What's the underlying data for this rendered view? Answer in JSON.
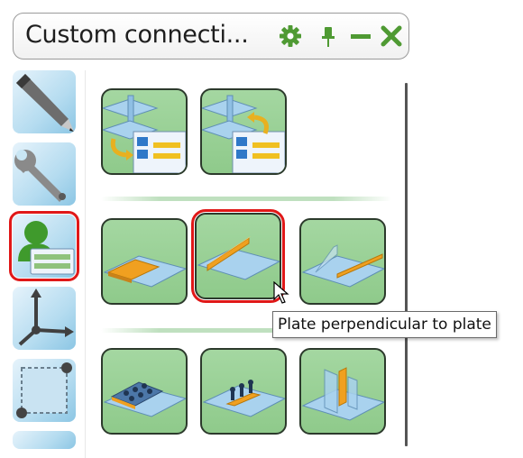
{
  "window": {
    "title": "Custom connecti...",
    "buttons": [
      {
        "name": "settings-icon"
      },
      {
        "name": "pin-icon"
      },
      {
        "name": "minimize-icon"
      },
      {
        "name": "close-icon"
      }
    ]
  },
  "sidebar": {
    "items": [
      {
        "icon": "pen-icon",
        "selected": false
      },
      {
        "icon": "wrench-icon",
        "selected": false
      },
      {
        "icon": "custom-component-user-icon",
        "selected": true
      },
      {
        "icon": "coordinate-axes-icon",
        "selected": false
      },
      {
        "icon": "dashed-plane-icon",
        "selected": false
      }
    ]
  },
  "tiles": [
    {
      "icon": "explode-beam-connection-icon",
      "selected": false
    },
    {
      "icon": "explode-beam-connection-reverse-icon",
      "selected": false
    },
    {
      "icon": "plate-on-plate-icon",
      "selected": false
    },
    {
      "icon": "plate-perpendicular-to-plate-icon",
      "selected": true
    },
    {
      "icon": "plate-edge-to-plate-icon",
      "selected": false
    },
    {
      "icon": "bolted-plates-icon",
      "selected": false
    },
    {
      "icon": "bolted-strip-plate-icon",
      "selected": false
    },
    {
      "icon": "vertical-plates-icon",
      "selected": false
    }
  ],
  "tooltip": {
    "text": "Plate perpendicular to plate"
  },
  "colors": {
    "selection": "#e01818",
    "tile_fill": "#8fca8b",
    "icon_green": "#4f9a33",
    "plate_blue": "#9ec9e6",
    "plate_orange": "#f0a020"
  }
}
